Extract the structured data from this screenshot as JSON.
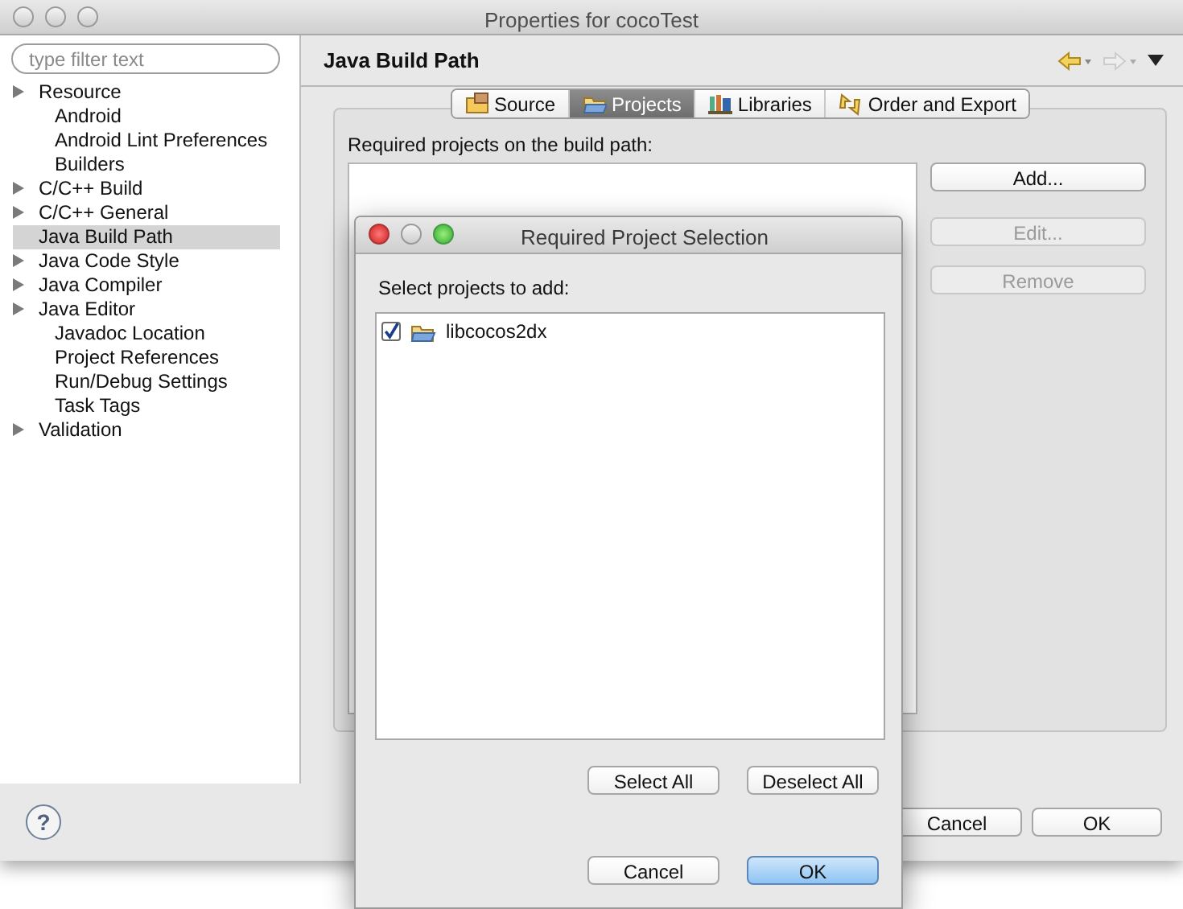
{
  "window": {
    "title": "Properties for cocoTest"
  },
  "filter": {
    "placeholder": "type filter text"
  },
  "tree": [
    {
      "label": "Resource",
      "expandable": true,
      "selected": false
    },
    {
      "label": "Android",
      "expandable": false,
      "selected": false
    },
    {
      "label": "Android Lint Preferences",
      "expandable": false,
      "selected": false
    },
    {
      "label": "Builders",
      "expandable": false,
      "selected": false
    },
    {
      "label": "C/C++ Build",
      "expandable": true,
      "selected": false
    },
    {
      "label": "C/C++ General",
      "expandable": true,
      "selected": false
    },
    {
      "label": "Java Build Path",
      "expandable": false,
      "selected": true
    },
    {
      "label": "Java Code Style",
      "expandable": true,
      "selected": false
    },
    {
      "label": "Java Compiler",
      "expandable": true,
      "selected": false
    },
    {
      "label": "Java Editor",
      "expandable": true,
      "selected": false
    },
    {
      "label": "Javadoc Location",
      "expandable": false,
      "selected": false
    },
    {
      "label": "Project References",
      "expandable": false,
      "selected": false
    },
    {
      "label": "Run/Debug Settings",
      "expandable": false,
      "selected": false
    },
    {
      "label": "Task Tags",
      "expandable": false,
      "selected": false
    },
    {
      "label": "Validation",
      "expandable": true,
      "selected": false
    }
  ],
  "page": {
    "title": "Java Build Path"
  },
  "tabs": [
    {
      "label": "Source",
      "kind": "source",
      "selected": false
    },
    {
      "label": "Projects",
      "kind": "projects",
      "selected": true
    },
    {
      "label": "Libraries",
      "kind": "libraries",
      "selected": false
    },
    {
      "label": "Order and Export",
      "kind": "order",
      "selected": false
    }
  ],
  "list_label": "Required projects on the build path:",
  "side_buttons": [
    {
      "label": "Add...",
      "disabled": false
    },
    {
      "label": "Edit...",
      "disabled": true
    },
    {
      "label": "Remove",
      "disabled": true
    }
  ],
  "help_button": "?",
  "buttons": [
    "Cancel",
    "OK"
  ],
  "dialog": {
    "title": "Required Project Selection",
    "prompt": "Select projects to add:",
    "projects": [
      {
        "name": "libcocos2dx",
        "checked": true
      }
    ],
    "select_buttons": [
      "Select All",
      "Deselect All"
    ],
    "buttons": [
      {
        "label": "Cancel",
        "default": false
      },
      {
        "label": "OK",
        "default": true
      }
    ]
  }
}
